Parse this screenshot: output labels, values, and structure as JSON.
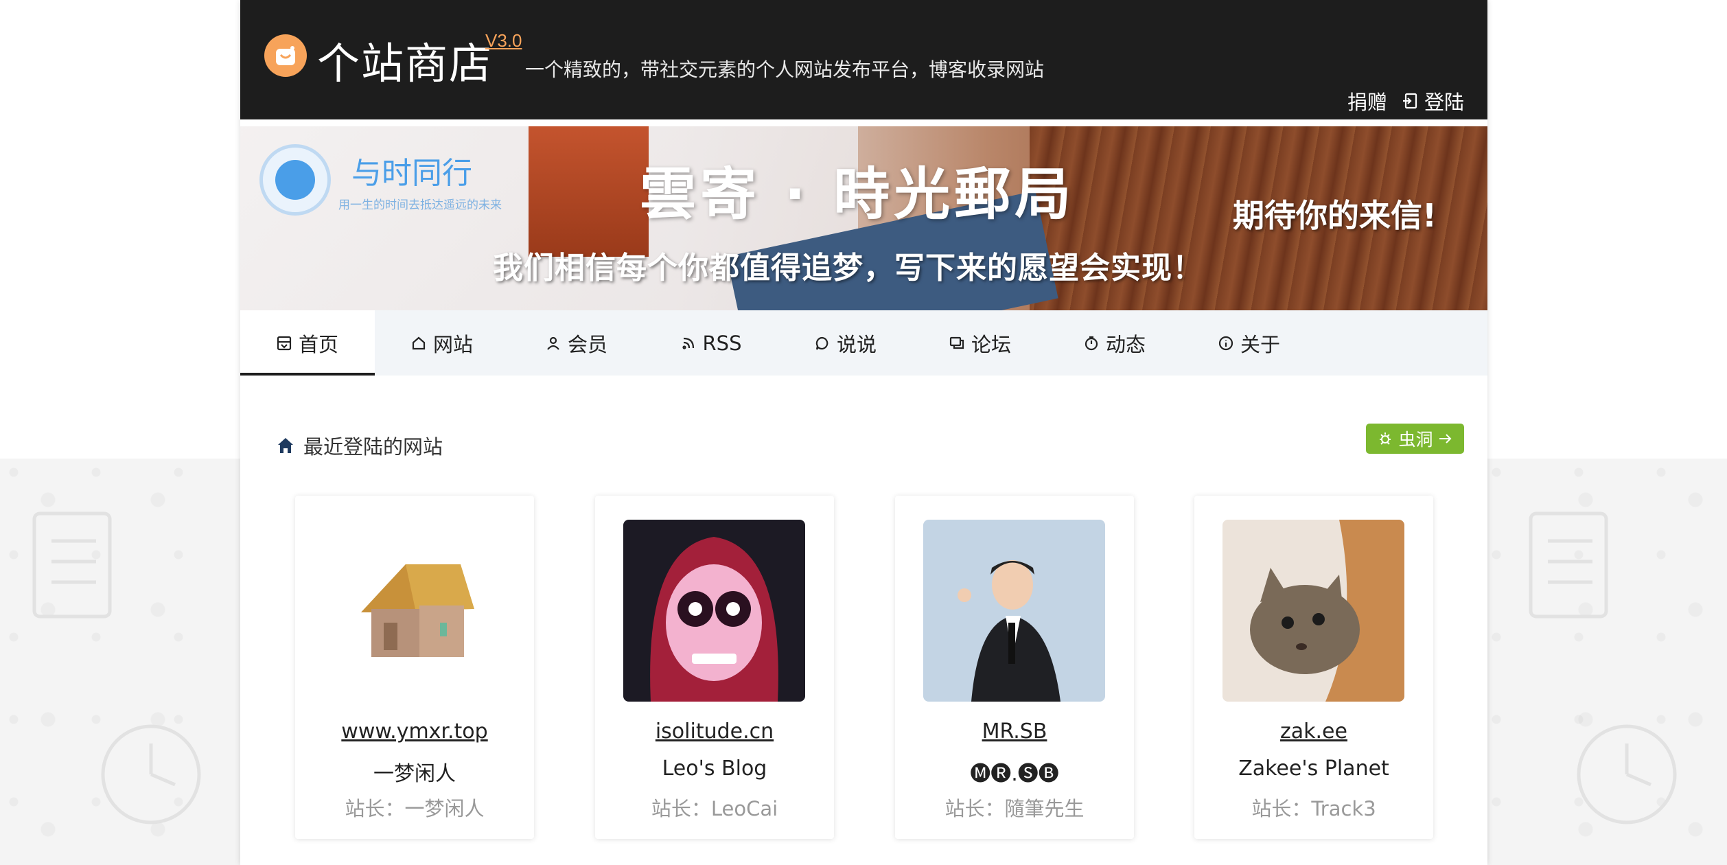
{
  "header": {
    "site_name": "个站商店",
    "version": "V3.0",
    "tagline": "一个精致的，带社交元素的个人网站发布平台，博客收录网站",
    "donate": "捐赠",
    "login": "登陆"
  },
  "banner": {
    "brand": "与时同行",
    "brand_sub": "用一生的时间去抵达遥远的未来",
    "title": "雲寄 · 時光郵局",
    "right_text": "期待你的来信!",
    "bottom_text": "我们相信每个你都值得追梦，写下来的愿望会实现！"
  },
  "nav": [
    {
      "label": "首页",
      "icon": "home-board-icon",
      "active": true
    },
    {
      "label": "网站",
      "icon": "house-icon",
      "active": false
    },
    {
      "label": "会员",
      "icon": "user-icon",
      "active": false
    },
    {
      "label": "RSS",
      "icon": "rss-icon",
      "active": false
    },
    {
      "label": "说说",
      "icon": "chat-bubble-icon",
      "active": false
    },
    {
      "label": "论坛",
      "icon": "forum-icon",
      "active": false
    },
    {
      "label": "动态",
      "icon": "stopwatch-icon",
      "active": false
    },
    {
      "label": "关于",
      "icon": "info-icon",
      "active": false
    }
  ],
  "section": {
    "title": "最近登陆的网站",
    "wormhole_label": "虫洞"
  },
  "cards": [
    {
      "domain": "www.ymxr.top",
      "title": "一梦闲人",
      "owner": "站长：一梦闲人",
      "avatar": "cottage-avatar"
    },
    {
      "domain": "isolitude.cn",
      "title": "Leo's Blog",
      "owner": "站长：LeoCai",
      "avatar": "skull-face-avatar"
    },
    {
      "domain": "MR.SB",
      "title": "🅜🅡.🅢🅑",
      "owner": "站长：隨筆先生",
      "avatar": "speaker-avatar"
    },
    {
      "domain": "zak.ee",
      "title": "Zakee's Planet",
      "owner": "站长：Track3",
      "avatar": "cat-avatar"
    }
  ],
  "colors": {
    "header_bg": "#1d1d1d",
    "accent_orange": "#f7a35a",
    "nav_bg": "#f2f5f8",
    "wormhole_green": "#7cb82f"
  }
}
